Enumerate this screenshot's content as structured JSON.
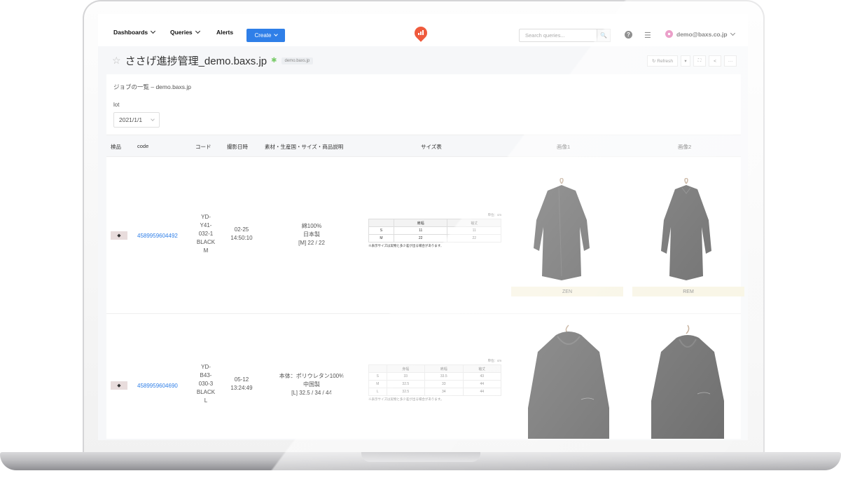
{
  "nav": {
    "dashboards": "Dashboards",
    "queries": "Queries",
    "alerts": "Alerts",
    "create": "Create",
    "search_placeholder": "Search queries...",
    "user": "demo@baxs.co.jp"
  },
  "dashboard": {
    "title": "ささげ進捗管理_demo.baxs.jp",
    "tag": "demo.baxs.jp",
    "refresh": "Refresh"
  },
  "widget": {
    "title": "ジョブの一覧 – demo.baxs.jp",
    "param_label": "lot",
    "param_value": "2021/1/1",
    "columns": [
      "検品",
      "code",
      "コード",
      "撮影日時",
      "素材・生産国・サイズ・商品説明",
      "サイズ表",
      "画像1",
      "画像2"
    ],
    "rows": [
      {
        "kenpin": "◆",
        "code": "4589959604492",
        "product_code": [
          "YD-",
          "Y41-",
          "032-1",
          "BLACK",
          "M"
        ],
        "shoot_date": "02-25",
        "shoot_time": "14:50:10",
        "desc": [
          "綿100%",
          "日本製",
          "[M] 22 / 22"
        ],
        "size_unit": "単位：cm",
        "size_headers": [
          "",
          "肩幅",
          "袖丈"
        ],
        "size_rows": [
          [
            "S",
            "11",
            "11"
          ],
          [
            "M",
            "22",
            "22"
          ]
        ],
        "size_note": "※表示サイズは実物と多少差が出る場合があります。",
        "img1_caption": "ZEN",
        "img2_caption": "REM"
      },
      {
        "kenpin": "◆",
        "code": "4589959604690",
        "product_code": [
          "YD-",
          "B43-",
          "030-3",
          "BLACK",
          "L"
        ],
        "shoot_date": "05-12",
        "shoot_time": "13:24:49",
        "desc": [
          "本体：ポリウレタン100%",
          "中国製",
          "[L] 32.5 / 34 / 44"
        ],
        "size_unit": "単位：cm",
        "size_headers": [
          "",
          "身幅",
          "肩幅",
          "袖丈"
        ],
        "size_rows": [
          [
            "S",
            "33",
            "33.5",
            "43"
          ],
          [
            "M",
            "32.5",
            "33",
            "44"
          ],
          [
            "L",
            "32.5",
            "34",
            "44"
          ]
        ],
        "size_note": "※表示サイズは実物と多少差が出る場合があります。"
      }
    ]
  },
  "colors": {
    "accent": "#2f7fe8",
    "logo": "#ef5a3c",
    "caption_bg": "#f5f0d8"
  },
  "icons": [
    "star-icon",
    "search-icon",
    "help-icon",
    "settings-icon",
    "avatar",
    "refresh-icon",
    "fullscreen-icon",
    "share-icon",
    "more-icon"
  ]
}
